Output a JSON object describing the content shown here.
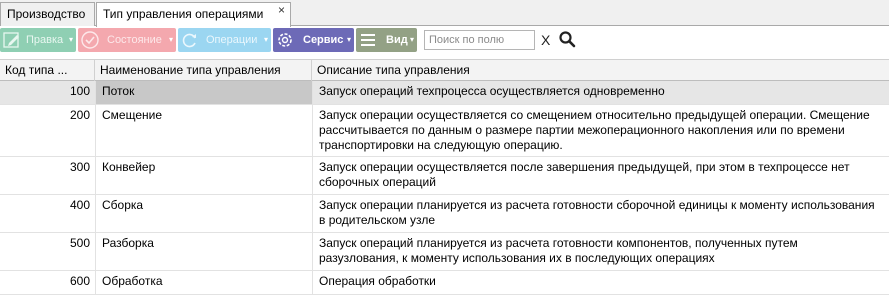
{
  "tabs": [
    {
      "label": "Производство",
      "close": ""
    },
    {
      "label": "Тип управления операциями",
      "close": "×"
    }
  ],
  "toolbar": {
    "edit_label": "Правка",
    "state_label": "Состояние",
    "ops_label": "Операции",
    "service_label": "Сервис",
    "view_label": "Вид",
    "caret": "▾",
    "search_placeholder": "Поиск по полю",
    "clear_label": "X",
    "colors": {
      "edit": "#8fcfb3",
      "state": "#f4a8ae",
      "ops": "#9bd6f1",
      "service": "#6d6ab7",
      "view": "#93a185"
    }
  },
  "grid": {
    "columns": [
      "Код типа ...",
      "Наименование типа управления",
      "Описание типа управления"
    ],
    "rows": [
      {
        "code": "100",
        "name": "Поток",
        "desc": "Запуск операций техпроцесса осуществляется одновременно",
        "selected": true
      },
      {
        "code": "200",
        "name": "Смещение",
        "desc": "Запуск операции осуществляется со смещением относительно предыдущей операции. Смещение рассчитывается по данным о размере партии межоперационного накопления или по времени транспортировки на следующую операцию."
      },
      {
        "code": "300",
        "name": "Конвейер",
        "desc": "Запуск операции осуществляется после завершения предыдущей, при этом в техпроцессе нет сборочных операций"
      },
      {
        "code": "400",
        "name": "Сборка",
        "desc": "Запуск операции планируется из расчета готовности сборочной единицы к моменту использования в родительском узле"
      },
      {
        "code": "500",
        "name": "Разборка",
        "desc": "Запуск операций планируется из расчета готовности компонентов, полученных путем разузлования, к моменту использования их в последующих операциях"
      },
      {
        "code": "600",
        "name": "Обработка",
        "desc": "Операция обработки"
      }
    ]
  }
}
